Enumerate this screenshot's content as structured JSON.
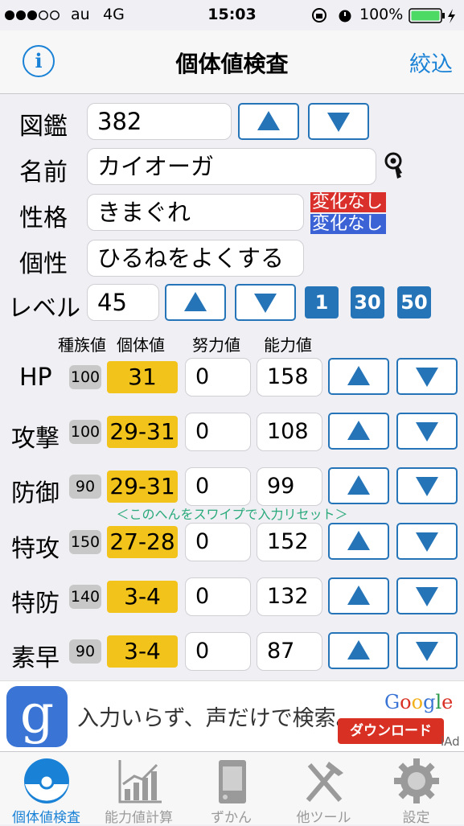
{
  "status": {
    "carrier": "au",
    "network": "4G",
    "time": "15:03",
    "battery": "100%"
  },
  "nav": {
    "info_label": "i",
    "title": "個体値検査",
    "filter_label": "絞込"
  },
  "form": {
    "dex_label": "図鑑",
    "dex_value": "382",
    "name_label": "名前",
    "name_value": "カイオーガ",
    "nature_label": "性格",
    "nature_value": "きまぐれ",
    "nature_up": "変化なし",
    "nature_down": "変化なし",
    "char_label": "個性",
    "char_value": "ひるねをよくする",
    "level_label": "レベル",
    "level_value": "45",
    "level_presets": [
      "1",
      "30",
      "50"
    ]
  },
  "columns": {
    "base": "種族値",
    "iv": "個体値",
    "ev": "努力値",
    "stat": "能力値"
  },
  "stats": [
    {
      "name": "HP",
      "base": "100",
      "iv": "31",
      "ev": "0",
      "value": "158"
    },
    {
      "name": "攻撃",
      "base": "100",
      "iv": "29-31",
      "ev": "0",
      "value": "108"
    },
    {
      "name": "防御",
      "base": "90",
      "iv": "29-31",
      "ev": "0",
      "value": "99"
    },
    {
      "name": "特攻",
      "base": "150",
      "iv": "27-28",
      "ev": "0",
      "value": "152"
    },
    {
      "name": "特防",
      "base": "140",
      "iv": "3-4",
      "ev": "0",
      "value": "132"
    },
    {
      "name": "素早",
      "base": "90",
      "iv": "3-4",
      "ev": "0",
      "value": "87"
    }
  ],
  "swipe_hint": "＜このへんをスワイプで入力リセット＞",
  "ad": {
    "icon": "g",
    "text": "入力いらず、声だけで検索。",
    "brand": "Google",
    "button": "ダウンロード",
    "badge": "iAd"
  },
  "tabs": [
    {
      "label": "個体値検査",
      "icon": "pokeball-icon",
      "active": true
    },
    {
      "label": "能力値計算",
      "icon": "chart-icon",
      "active": false
    },
    {
      "label": "ずかん",
      "icon": "pokedex-icon",
      "active": false
    },
    {
      "label": "他ツール",
      "icon": "tools-icon",
      "active": false
    },
    {
      "label": "設定",
      "icon": "gear-icon",
      "active": false
    }
  ],
  "colors": {
    "accent": "#1a82d6",
    "button_border": "#2574b8",
    "iv_highlight": "#f2c31b",
    "nature_up": "#d9302c",
    "nature_down": "#3b63d6",
    "hint": "#2aaa7a"
  }
}
